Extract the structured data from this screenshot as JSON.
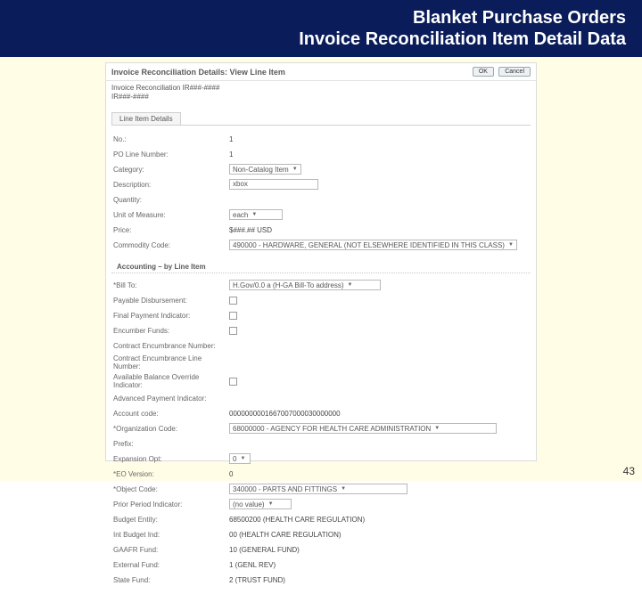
{
  "slide": {
    "title_line1": "Blanket Purchase Orders",
    "title_line2": "Invoice Reconciliation Item Detail Data",
    "page_number": "43"
  },
  "panel": {
    "header": "Invoice Reconciliation Details: View Line Item",
    "buttons": {
      "ok": "OK",
      "cancel": "Cancel"
    },
    "identity": {
      "line1": "Invoice Reconciliation IR###-####",
      "line2": "IR###-####"
    },
    "tab_label": "Line Item Details",
    "line_item": {
      "no_label": "No.:",
      "no_value": "1",
      "po_line_number_label": "PO Line Number:",
      "po_line_number_value": "1",
      "category_label": "Category:",
      "category_value": "Non-Catalog Item",
      "description_label": "Description:",
      "description_value": "xbox",
      "quantity_label": "Quantity:",
      "unit_of_measure_label": "Unit of Measure:",
      "unit_of_measure_value": "each",
      "price_label": "Price:",
      "price_value": "$###.## USD",
      "commodity_code_label": "Commodity Code:",
      "commodity_code_value": "490000 - HARDWARE, GENERAL (NOT ELSEWHERE IDENTIFIED IN THIS CLASS)"
    },
    "section_heading": "Accounting – by Line Item",
    "accounting": {
      "bill_to_label": "*Bill To:",
      "bill_to_value": "H.Gov/0.0 a (H-GA Bill-To address)",
      "payable_disbursement_label": "Payable Disbursement:",
      "final_payment_indicator_label": "Final Payment Indicator:",
      "encumber_funds_label": "Encumber Funds:",
      "contract_encumbrance_number_label": "Contract Encumbrance Number:",
      "contract_encumbrance_line_number_label": "Contract Encumbrance Line Number:",
      "available_balance_override_indicator_label": "Available Balance Override Indicator:",
      "advanced_payment_indicator_label": "Advanced Payment Indicator:",
      "account_code_label": "Account code:",
      "account_code_value": "0000000001667007000030000000",
      "organization_code_label": "*Organization Code:",
      "organization_code_value": "68000000 - AGENCY FOR HEALTH CARE ADMINISTRATION",
      "prefix_label": "Prefix:",
      "expansion_opt_label": "Expansion Opt:",
      "expansion_opt_value": "0",
      "eo_version_label": "*EO Version:",
      "eo_version_value": "0",
      "object_code_label": "*Object Code:",
      "object_code_value": "340000 - PARTS AND FITTINGS",
      "prior_period_indicator_label": "Prior Period Indicator:",
      "prior_period_indicator_value": "(no value)",
      "budget_entity_label": "Budget Entity:",
      "budget_entity_value": "68500200 (HEALTH CARE REGULATION)",
      "int_budget_ind_label": "Int Budget Ind:",
      "int_budget_ind_value": "00 (HEALTH CARE REGULATION)",
      "gaafr_fund_label": "GAAFR Fund:",
      "gaafr_fund_value": "10 (GENERAL FUND)",
      "external_fund_label": "External Fund:",
      "external_fund_value": "1 (GENL REV)",
      "state_fund_label": "State Fund:",
      "state_fund_value": "2 (TRUST FUND)"
    }
  }
}
